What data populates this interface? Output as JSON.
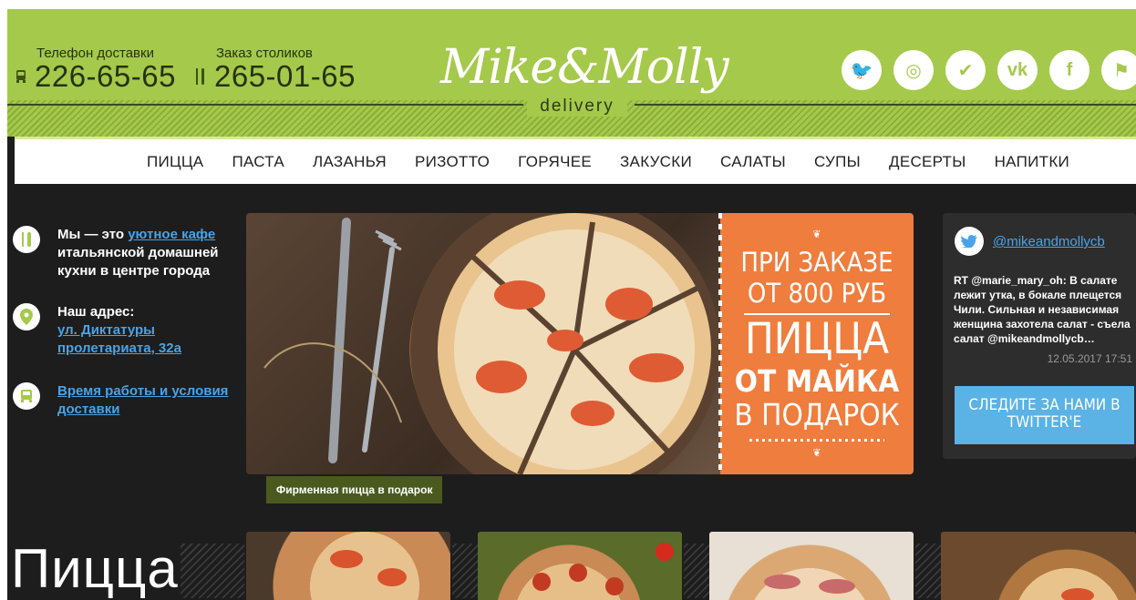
{
  "header": {
    "delivery": {
      "label": "Телефон доставки",
      "number": "226-65-65"
    },
    "reservation": {
      "label": "Заказ столиков",
      "number": "265-01-65"
    },
    "logo_text": "Mike&Molly",
    "logo_sub": "delivery",
    "socials": [
      {
        "name": "twitter-icon",
        "glyph": "🐦"
      },
      {
        "name": "instagram-icon",
        "glyph": "◎"
      },
      {
        "name": "foursquare-icon",
        "glyph": "✔"
      },
      {
        "name": "vk-icon",
        "glyph": "vk"
      },
      {
        "name": "facebook-icon",
        "glyph": "f"
      },
      {
        "name": "flag-icon",
        "glyph": "⚑"
      }
    ],
    "brand_color": "#a5c94a"
  },
  "nav": [
    "ПИЦЦА",
    "ПАСТА",
    "ЛАЗАНЬЯ",
    "РИЗОТТО",
    "ГОРЯЧЕЕ",
    "ЗАКУСКИ",
    "САЛАТЫ",
    "СУПЫ",
    "ДЕСЕРТЫ",
    "НАПИТКИ"
  ],
  "info": {
    "about_prefix": "Мы — это ",
    "about_link": "уютное кафе",
    "about_rest": "итальянской домашней кухни в центре города",
    "address_label": "Наш адрес:",
    "address_link": "ул. Диктатуры пролетариата, 32а",
    "hours_link": "Время работы и условия доставки"
  },
  "banner": {
    "line1": "ПРИ ЗАКАЗЕ",
    "line2": "ОТ 800 РУБ",
    "line3": "ПИЦЦА",
    "line4": "ОТ МАЙКА",
    "line5": "В ПОДАРОК",
    "caption": "Фирменная пицца в подарок",
    "promo_color": "#ef7d3d"
  },
  "twitter": {
    "handle": "@mikeandmollycb",
    "text": "RT @marie_mary_oh: В салате лежит утка, в бокале плещется Чили. Сильная и независимая женщина захотела салат - съела салат @mikeandmollycb…",
    "date": "12.05.2017 17:51",
    "follow": "СЛЕДИТЕ ЗА НАМИ В TWITTER'E",
    "accent": "#5ab2e5"
  },
  "section": {
    "title": "Пицца"
  }
}
